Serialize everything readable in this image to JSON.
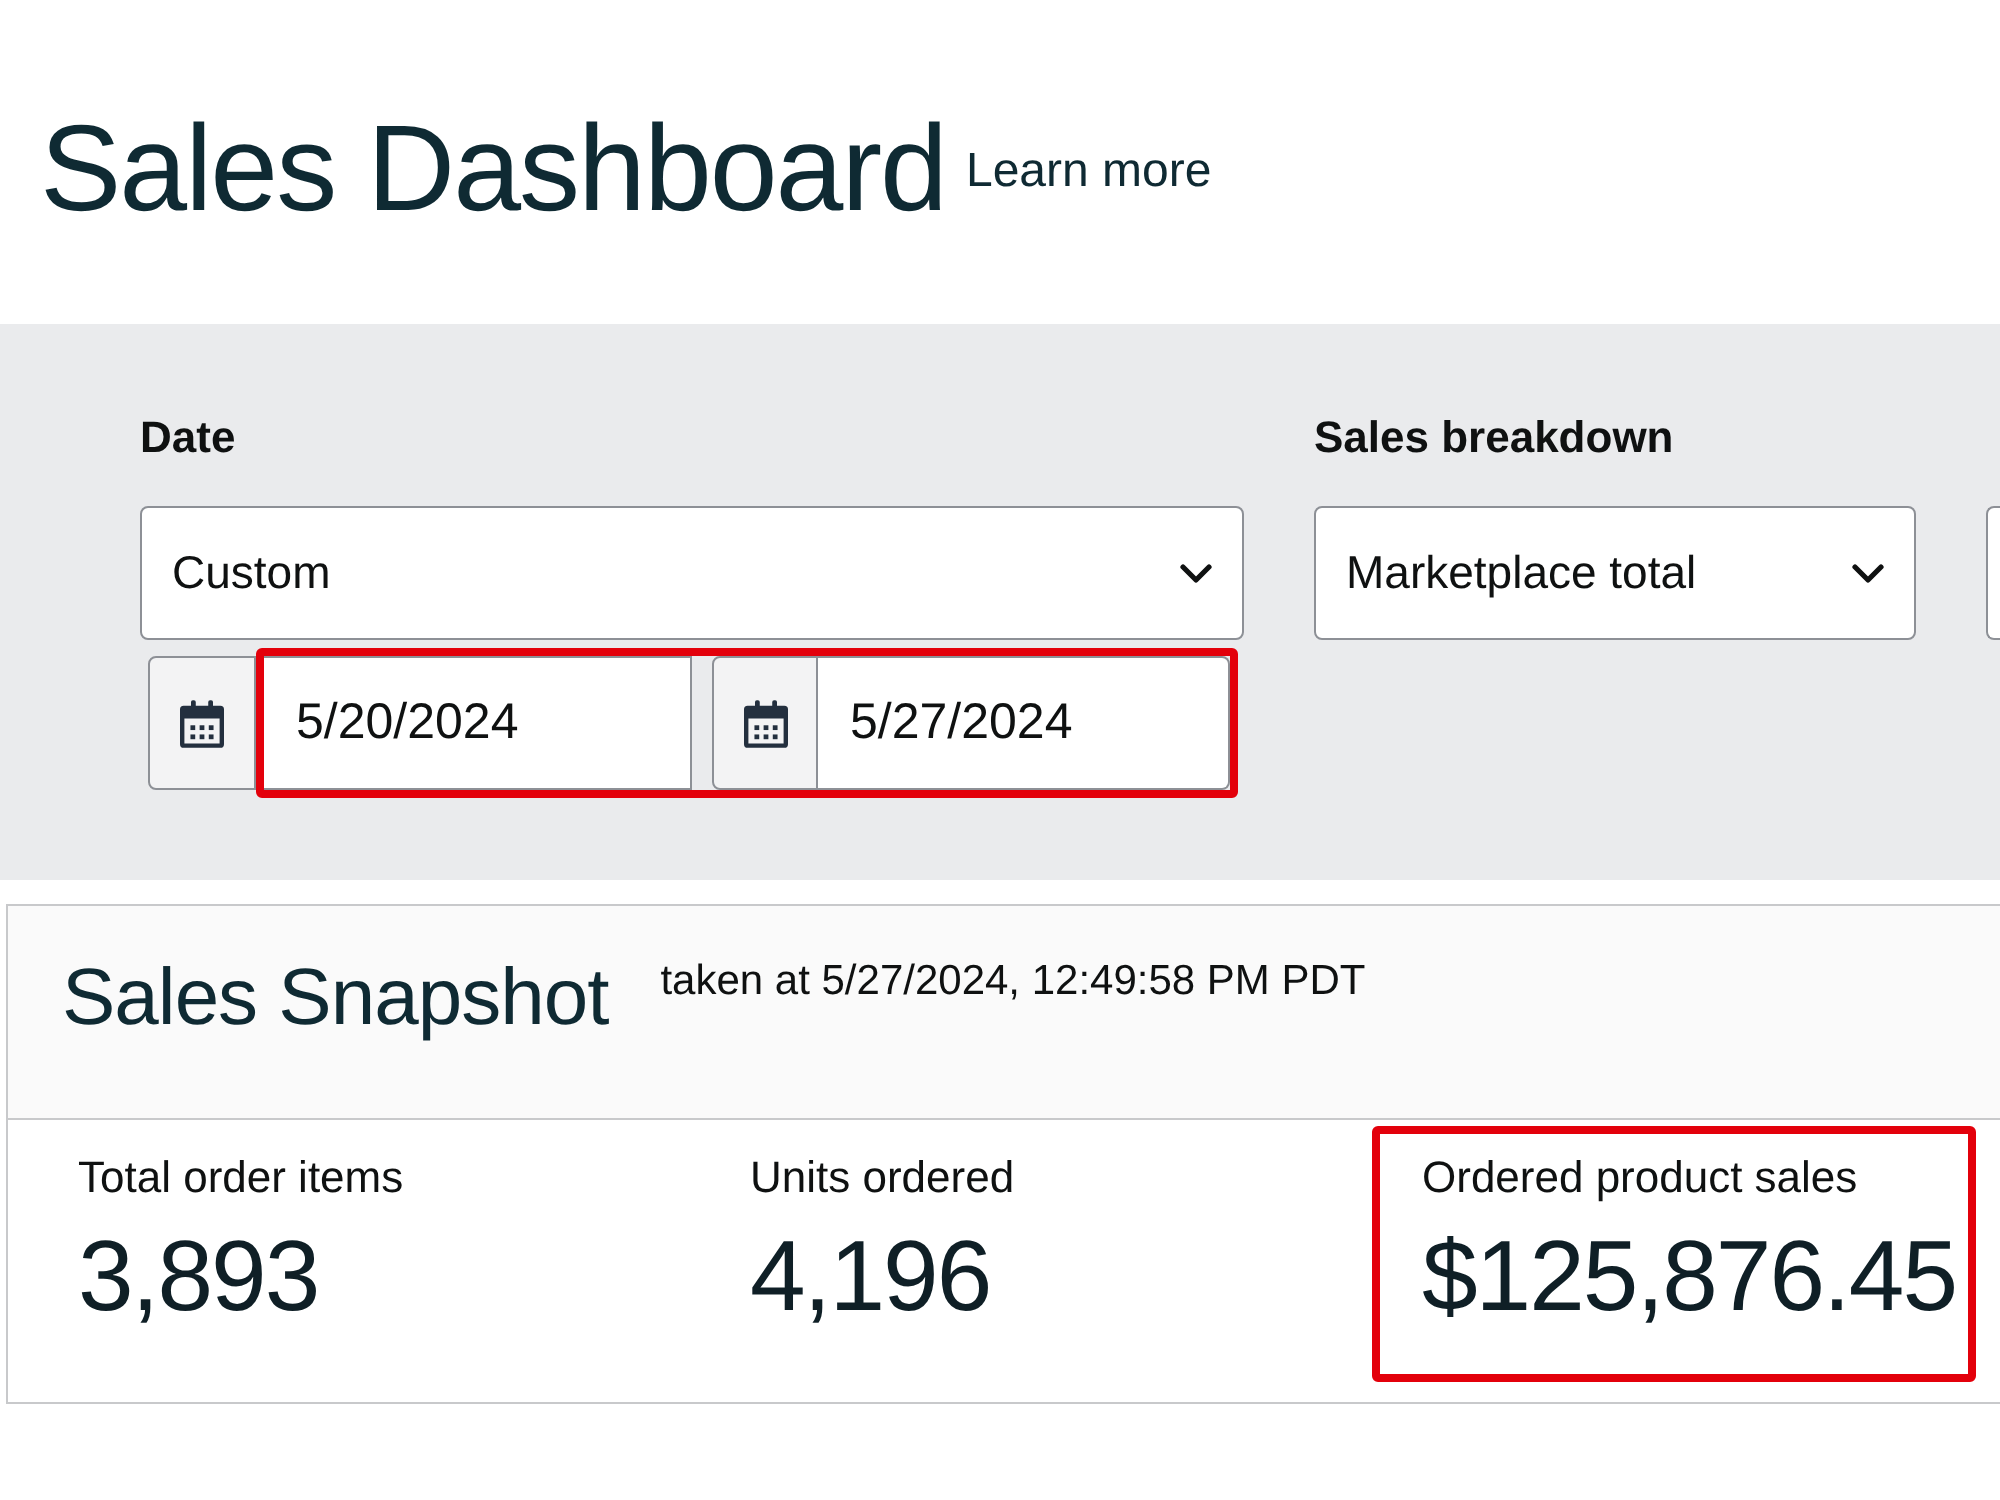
{
  "header": {
    "title": "Sales Dashboard",
    "link": "Learn more"
  },
  "filters": [
    {
      "kind": "date",
      "label": "Date",
      "value": "Custom",
      "range": {
        "highlighted": true,
        "start": "5/20/2024",
        "end": "5/27/2024"
      }
    },
    {
      "kind": "select",
      "label": "Sales breakdown",
      "value": "Marketplace total"
    },
    {
      "kind": "select"
    }
  ],
  "snapshot": {
    "title": "Sales Snapshot",
    "taken_at": "taken at 5/27/2024, 12:49:58 PM PDT",
    "metrics": [
      {
        "label": "Total order items",
        "value": "3,893",
        "highlighted": false
      },
      {
        "label": "Units ordered",
        "value": "4,196",
        "highlighted": false
      },
      {
        "label": "Ordered product sales",
        "value": "$125,876.45",
        "highlighted": true
      }
    ]
  }
}
